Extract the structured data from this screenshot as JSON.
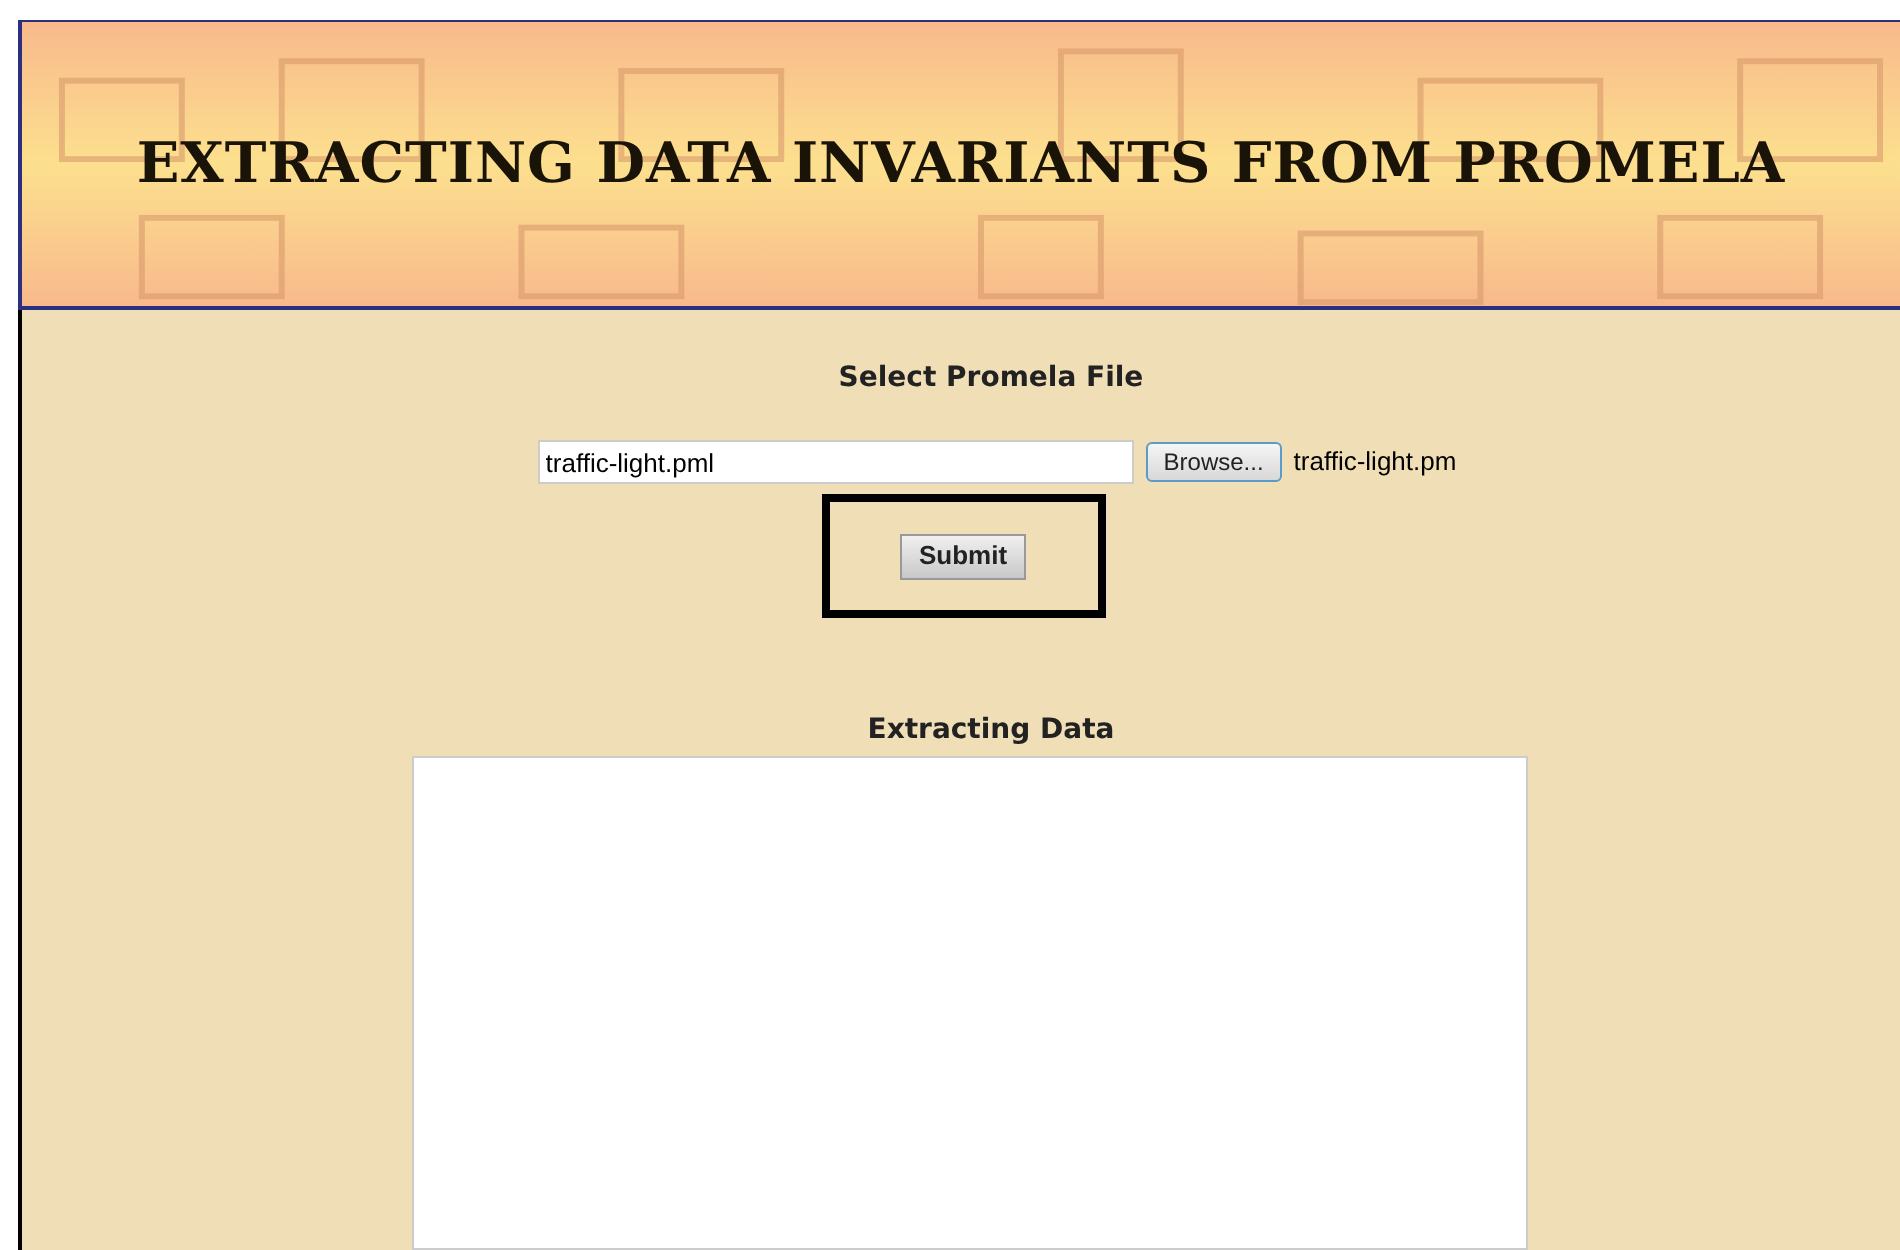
{
  "banner": {
    "title": "EXTRACTING DATA INVARIANTS FROM PROMELA"
  },
  "file_section": {
    "heading": "Select Promela File",
    "file_field": {
      "value": "traffic-light.pml"
    },
    "browse_button": "Browse...",
    "file_name": "traffic-light.pm",
    "submit_button": "Submit",
    "submit_highlighted": true
  },
  "output_section": {
    "heading": "Extracting Data"
  }
}
